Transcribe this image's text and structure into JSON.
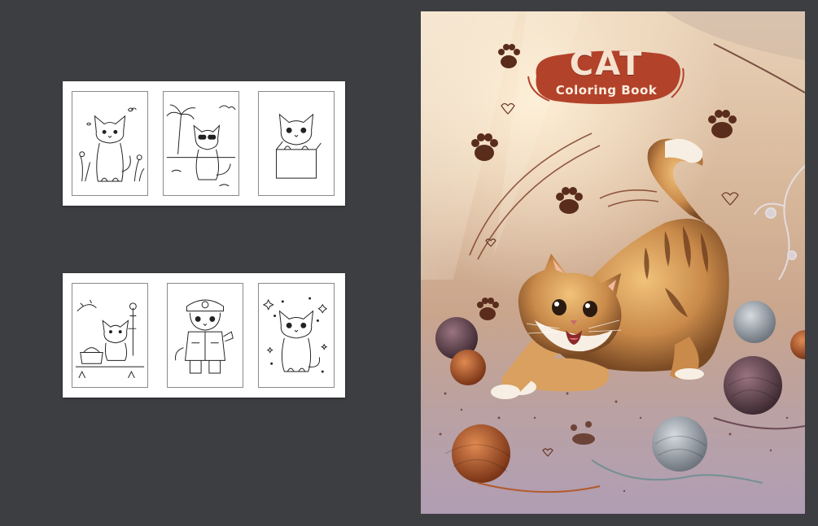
{
  "preview_strips": [
    {
      "pages": [
        {
          "subject": "cat with butterflies and flowers"
        },
        {
          "subject": "cat with sunglasses on beach"
        },
        {
          "subject": "kitten in box"
        }
      ]
    },
    {
      "pages": [
        {
          "subject": "cat with picnic basket"
        },
        {
          "subject": "firefighter cat"
        },
        {
          "subject": "kitten with sparkles"
        }
      ]
    }
  ],
  "cover": {
    "title": "CAT",
    "subtitle": "Coloring Book",
    "colors": {
      "badge": "#b3422a",
      "title_text": "#f6e3cf",
      "paw": "#5a2c1c",
      "cat_orange": "#c98a4a",
      "yarn_brown": "#b35a2c",
      "yarn_gray": "#8a9098",
      "yarn_plum": "#6b4a55"
    }
  }
}
